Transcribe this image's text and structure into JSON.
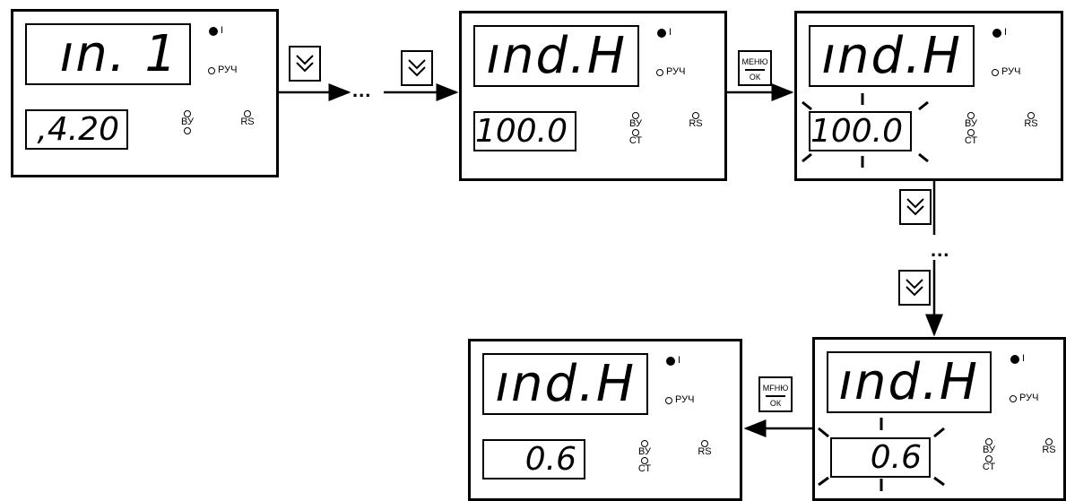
{
  "panels": [
    {
      "upper": "ın. 1",
      "lower": ",4.20",
      "led_i": "I",
      "led_ruch": "РУЧ",
      "led_vu": "ВУ",
      "led_st": "",
      "led_rs": "RS"
    },
    {
      "upper": "ınd.H",
      "lower": "100.0",
      "led_i": "I",
      "led_ruch": "РУЧ",
      "led_vu": "ВУ",
      "led_st": "СТ",
      "led_rs": "RS"
    },
    {
      "upper": "ınd.H",
      "lower": "100.0",
      "led_i": "I",
      "led_ruch": "РУЧ",
      "led_vu": "ВУ",
      "led_st": "СТ",
      "led_rs": "RS"
    },
    {
      "upper": "ınd.H",
      "lower": "0.6",
      "led_i": "I",
      "led_ruch": "РУЧ",
      "led_vu": "ВУ",
      "led_st": "СТ",
      "led_rs": "RS"
    },
    {
      "upper": "ınd.H",
      "lower": "0.6",
      "led_i": "I",
      "led_ruch": "РУЧ",
      "led_vu": "ВУ",
      "led_st": "СТ",
      "led_rs": "RS"
    }
  ],
  "keys": {
    "menu_top_a": "МЕНЮ",
    "menu_top_b": "МFНЮ",
    "menu_bottom": "ОК",
    "down_icon": "double-chevron-down-icon"
  },
  "ellipsis": "...",
  "colors": {
    "ink": "#000000",
    "background": "#ffffff"
  }
}
